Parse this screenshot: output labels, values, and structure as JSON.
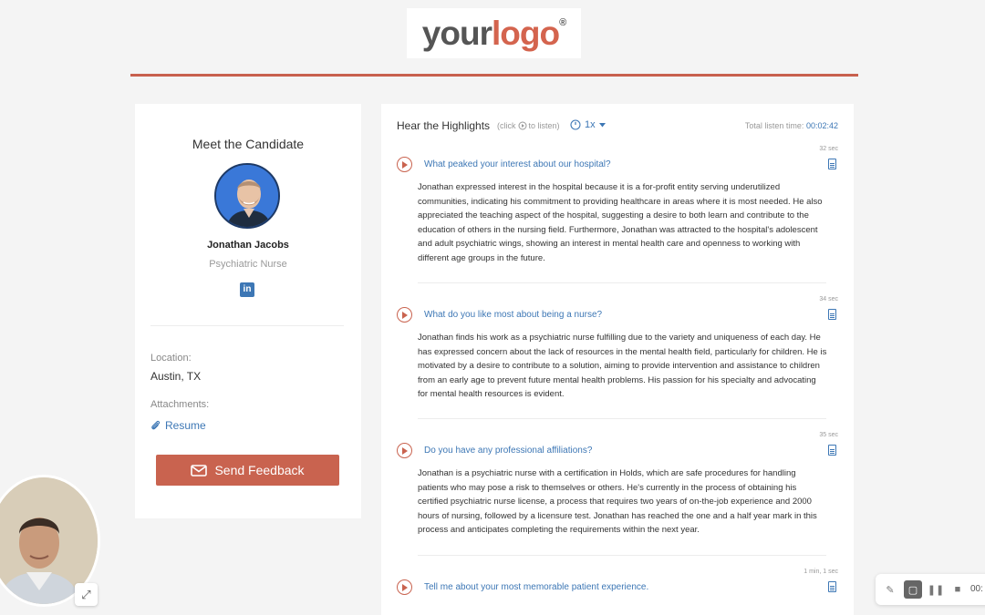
{
  "logo": {
    "your": "your",
    "logo": "logo",
    "reg": "®"
  },
  "candidate": {
    "heading": "Meet the Candidate",
    "name": "Jonathan Jacobs",
    "role": "Psychiatric Nurse",
    "linkedin_label": "in",
    "location_label": "Location:",
    "location": "Austin, TX",
    "attachments_label": "Attachments:",
    "resume_label": "Resume",
    "feedback_button": "Send Feedback"
  },
  "highlights": {
    "title": "Hear the Highlights",
    "hint_prefix": "(click",
    "hint_suffix": "to listen)",
    "speed": "1x",
    "total_label": "Total listen time:",
    "total_value": "00:02:42",
    "questions": [
      {
        "question": "What peaked your interest about our hospital?",
        "duration": "32 sec",
        "answer": "Jonathan expressed interest in the hospital because it is a for-profit entity serving underutilized communities, indicating his commitment to providing healthcare in areas where it is most needed. He also appreciated the teaching aspect of the hospital, suggesting a desire to both learn and contribute to the education of others in the nursing field. Furthermore, Jonathan was attracted to the hospital's adolescent and adult psychiatric wings, showing an interest in mental health care and openness to working with different age groups in the future."
      },
      {
        "question": "What do you like most about being a nurse?",
        "duration": "34 sec",
        "answer": "Jonathan finds his work as a psychiatric nurse fulfilling due to the variety and uniqueness of each day. He has expressed concern about the lack of resources in the mental health field, particularly for children. He is motivated by a desire to contribute to a solution, aiming to provide intervention and assistance to children from an early age to prevent future mental health problems. His passion for his specialty and advocating for mental health resources is evident."
      },
      {
        "question": "Do you have any professional affiliations?",
        "duration": "35 sec",
        "answer": "Jonathan is a psychiatric nurse with a certification in Holds, which are safe procedures for handling patients who may pose a risk to themselves or others. He's currently in the process of obtaining his certified psychiatric nurse license, a process that requires two years of on-the-job experience and 2000 hours of nursing, followed by a licensure test. Jonathan has reached the one and a half year mark in this process and anticipates completing the requirements within the next year."
      },
      {
        "question": "Tell me about your most memorable patient experience.",
        "duration": "1 min, 1 sec",
        "answer": ""
      }
    ]
  },
  "recorder": {
    "time": "00:"
  },
  "colors": {
    "accent": "#c9634f",
    "link": "#3d77b5"
  }
}
